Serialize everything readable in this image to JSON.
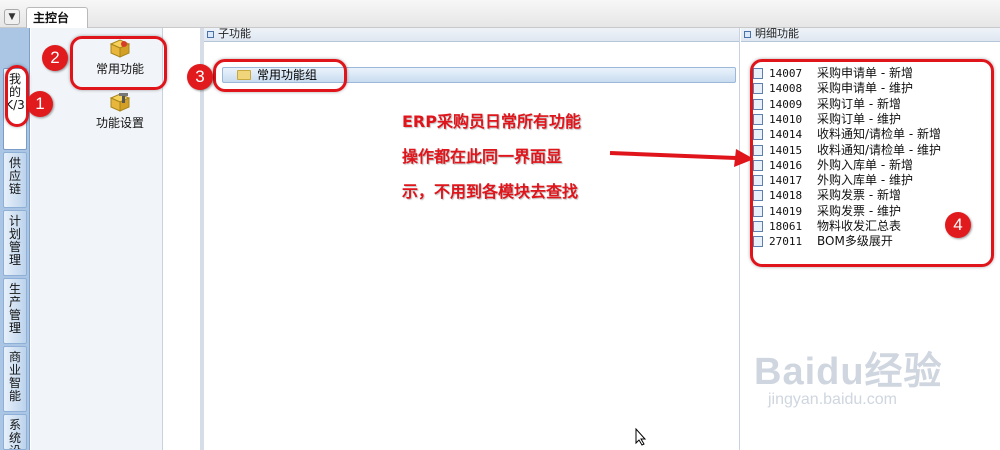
{
  "topbar": {
    "tab_label": "主控台"
  },
  "sidebar": {
    "tabs": [
      {
        "label": "我的K/3"
      },
      {
        "label": "供应链"
      },
      {
        "label": "计划管理"
      },
      {
        "label": "生产管理"
      },
      {
        "label": "商业智能"
      },
      {
        "label": "系统设置"
      }
    ]
  },
  "func_panel": {
    "items": [
      {
        "label": "常用功能",
        "icon": "box-icon"
      },
      {
        "label": "功能设置",
        "icon": "box-gear-icon"
      }
    ]
  },
  "sub_panel": {
    "header": "子功能",
    "group": "常用功能组"
  },
  "detail_panel": {
    "header": "明细功能",
    "items": [
      {
        "code": "14007",
        "name": "采购申请单 - 新增"
      },
      {
        "code": "14008",
        "name": "采购申请单 - 维护"
      },
      {
        "code": "14009",
        "name": "采购订单 - 新增"
      },
      {
        "code": "14010",
        "name": "采购订单 - 维护"
      },
      {
        "code": "14014",
        "name": "收料通知/请检单 - 新增"
      },
      {
        "code": "14015",
        "name": "收料通知/请检单 - 维护"
      },
      {
        "code": "14016",
        "name": "外购入库单 - 新增"
      },
      {
        "code": "14017",
        "name": "外购入库单 - 维护"
      },
      {
        "code": "14018",
        "name": "采购发票 - 新增"
      },
      {
        "code": "14019",
        "name": "采购发票 - 维护"
      },
      {
        "code": "18061",
        "name": "物料收发汇总表"
      },
      {
        "code": "27011",
        "name": "BOM多级展开"
      }
    ]
  },
  "annotation": {
    "lines": [
      "ERP采购员日常所有功能",
      "操作都在此同一界面显",
      "示，不用到各模块去查找"
    ],
    "color": "#e0141b"
  },
  "badges": [
    "1",
    "2",
    "3",
    "4"
  ],
  "watermark": {
    "brand": "Baidu经验",
    "url": "jingyan.baidu.com"
  }
}
